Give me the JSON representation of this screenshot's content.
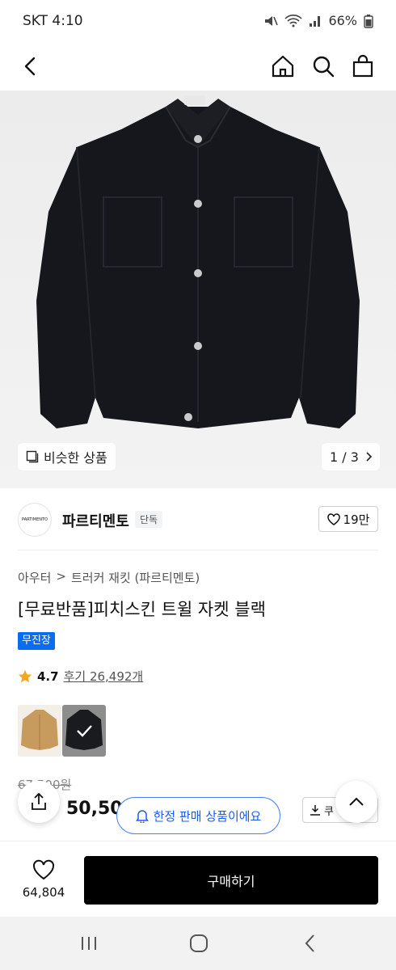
{
  "status_bar": {
    "carrier_time": "SKT 4:10",
    "battery": "66%"
  },
  "hero": {
    "similar_label": "비슷한 상품",
    "pager": "1 / 3"
  },
  "brand": {
    "logo_text": "PARTIMENTO",
    "name": "파르티멘토",
    "badge": "단독",
    "likes": "19만"
  },
  "breadcrumb": {
    "cat1": "아우터",
    "sep": ">",
    "cat2": "트러커 재킷 (파르티멘토)"
  },
  "product": {
    "title": "[무료반품]피치스킨 트윌 자켓 블랙",
    "tag": "무진장",
    "rating": "4.7",
    "reviews": "후기 26,492개",
    "original_price": "67,500원",
    "sale_price": "50,50",
    "coupon_label": "쿠",
    "limited_notice": "한정 판매 상품이에요"
  },
  "bottom": {
    "wish_count": "64,804",
    "buy_label": "구매하기"
  },
  "colors": {
    "accent_blue": "#0a6cf0",
    "buy_bg": "#000000",
    "star": "#f5a623"
  },
  "icons": [
    "back-icon",
    "home-icon",
    "search-icon",
    "bag-icon",
    "similar-icon",
    "chevron-right-icon",
    "heart-icon",
    "star-icon",
    "share-icon",
    "bell-icon",
    "download-icon",
    "chevron-up-icon",
    "check-icon",
    "recents-icon",
    "home-circle-icon",
    "back-nav-icon"
  ]
}
